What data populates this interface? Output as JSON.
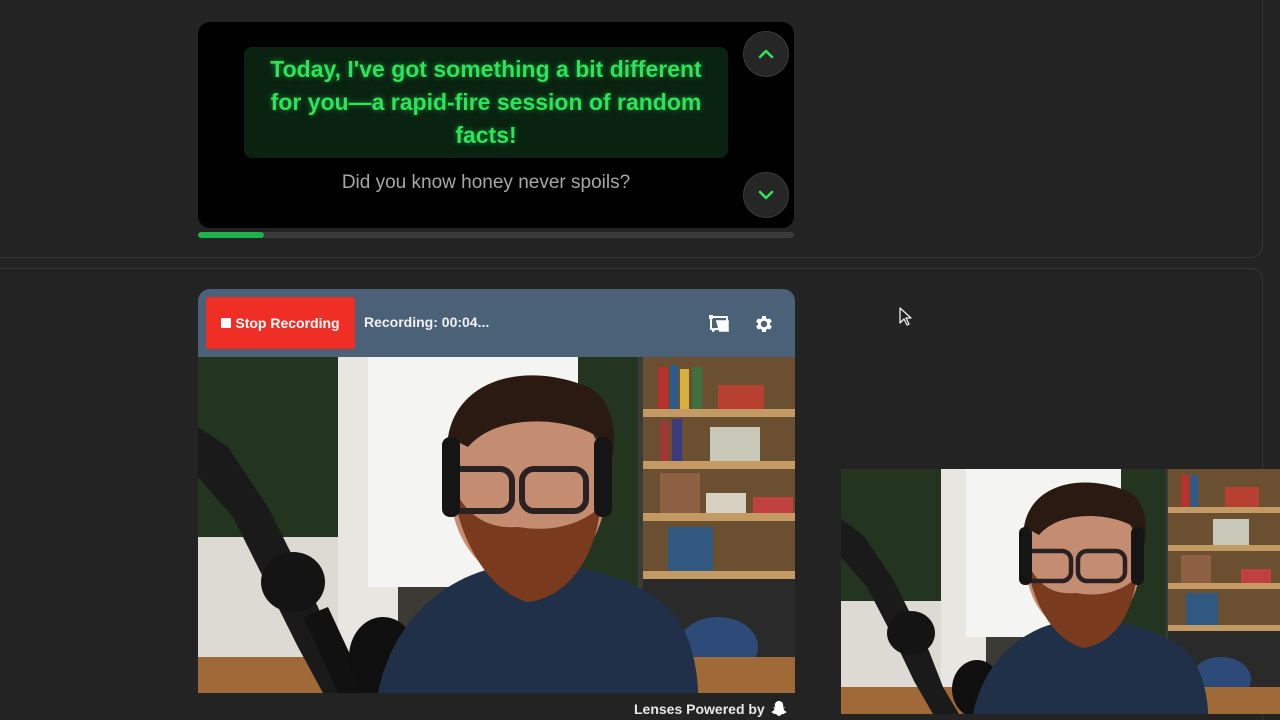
{
  "teleprompter": {
    "current_line": "Today, I've got something a bit different for you—a rapid-fire session of random facts!",
    "next_line": "Did you know honey never spoils?",
    "progress_fraction": 0.11,
    "up_icon": "chevron-up-icon",
    "down_icon": "chevron-down-icon",
    "accent_color": "#2ee25a"
  },
  "recorder": {
    "stop_label": "Stop Recording",
    "status": "Recording: 00:04...",
    "toolbar_icons": [
      "teleprompter-icon",
      "gear-icon"
    ],
    "bar_color": "#4b6178",
    "stop_color": "#ef2f26"
  },
  "footer": {
    "lenses_label": "Lenses Powered by",
    "lenses_icon": "snapchat-ghost-icon"
  }
}
